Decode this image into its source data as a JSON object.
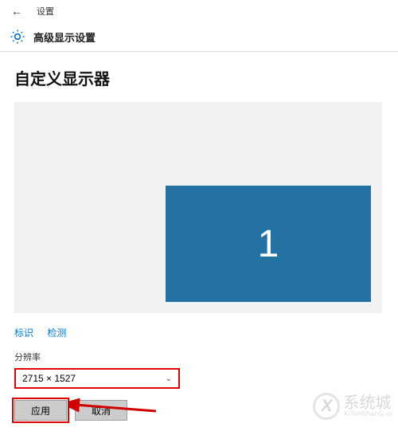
{
  "titlebar": {
    "label": "设置"
  },
  "header": {
    "title": "高级显示设置"
  },
  "page": {
    "title": "自定义显示器"
  },
  "monitor": {
    "number": "1"
  },
  "links": {
    "identify": "标识",
    "detect": "检测"
  },
  "resolution": {
    "label": "分辨率",
    "value": "2715 × 1527"
  },
  "buttons": {
    "apply": "应用",
    "cancel": "取消"
  },
  "watermark": {
    "logo": "X",
    "name": "系统城",
    "url": "XiTonGhanG.cc"
  }
}
